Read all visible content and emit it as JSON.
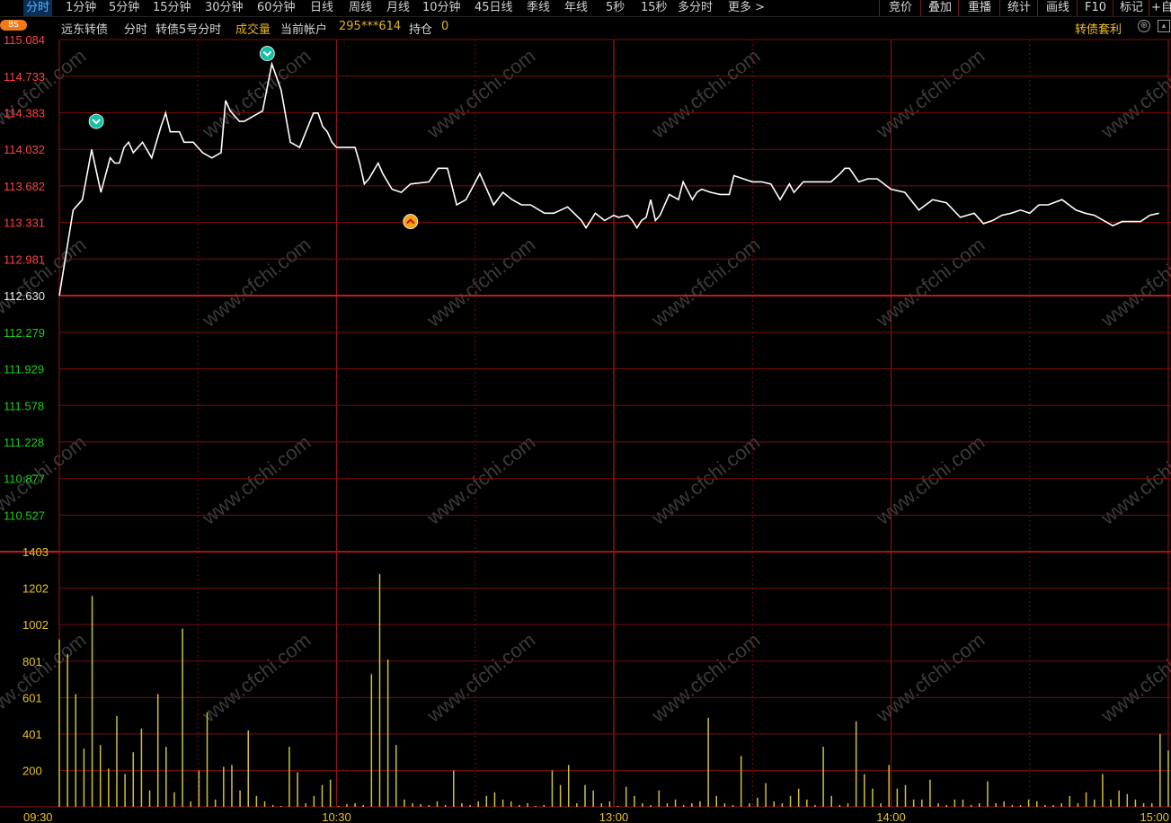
{
  "toolbar": {
    "tabs": [
      "分时",
      "1分钟",
      "5分钟",
      "15分钟",
      "30分钟",
      "60分钟",
      "日线",
      "周线",
      "月线",
      "10分钟",
      "45日线",
      "季线",
      "年线",
      "5秒",
      "15秒",
      "多分时",
      "更多 >"
    ],
    "right_buttons": [
      "竞价",
      "叠加",
      "重播",
      "统计",
      "画线",
      "F10",
      "标记",
      "+自"
    ]
  },
  "header": {
    "badge": "BS",
    "stock_name": "远东转债",
    "view": "分时",
    "chart_name": "转债5号分时",
    "volume_label": "成交量",
    "account_label": "当前帐户",
    "account_value": "295***614",
    "position_label": "持仓",
    "position_value": "0",
    "arbitrage": "转债套利"
  },
  "colors": {
    "up": "#ff4040",
    "down": "#19d019",
    "flat": "#e6e6e6",
    "volume": "#cfc13a",
    "grid": "#7a0c0c",
    "price_line": "#ffffff"
  },
  "chart_data": {
    "type": "line",
    "price": {
      "ylim": [
        110.177,
        115.084
      ],
      "prev_close": 112.63,
      "y_ticks": [
        "115.084",
        "114.733",
        "114.383",
        "114.032",
        "113.682",
        "113.331",
        "112.981",
        "112.630",
        "112.279",
        "111.929",
        "111.578",
        "111.228",
        "110.877",
        "110.527"
      ],
      "series": {
        "name": "",
        "x": [
          0,
          3,
          5,
          7,
          9,
          11,
          12,
          13,
          14,
          15,
          16,
          18,
          20,
          22,
          23,
          24,
          26,
          27,
          29,
          30,
          31,
          33,
          35,
          36,
          37,
          39,
          40,
          42,
          44,
          46,
          48,
          50,
          52,
          55,
          56,
          57,
          58,
          59,
          60,
          62,
          64,
          65,
          66,
          67,
          69,
          70,
          72,
          74,
          76,
          80,
          82,
          84,
          86,
          88,
          91,
          94,
          96,
          98,
          100,
          102,
          105,
          107,
          110,
          113,
          114,
          115,
          116,
          118,
          120,
          121,
          123,
          124,
          125,
          126,
          127,
          128,
          129,
          130,
          132,
          134,
          135,
          137,
          138,
          139,
          141,
          143,
          145,
          146,
          148,
          150,
          152,
          154,
          156,
          158,
          159,
          161,
          163,
          165,
          167,
          169,
          170,
          171,
          173,
          175,
          177,
          180,
          183,
          186,
          189,
          192,
          195,
          198,
          200,
          202,
          204,
          206,
          208,
          210,
          212,
          214,
          217,
          220,
          222,
          224,
          226,
          228,
          230,
          232,
          234,
          236,
          238,
          240
        ],
        "y": [
          112.63,
          113.45,
          113.55,
          114.03,
          113.62,
          113.95,
          113.9,
          113.9,
          114.05,
          114.1,
          114.0,
          114.1,
          113.95,
          114.25,
          114.38,
          114.2,
          114.2,
          114.1,
          114.1,
          114.05,
          114.0,
          113.95,
          114.0,
          114.5,
          114.4,
          114.3,
          114.3,
          114.35,
          114.4,
          114.85,
          114.6,
          114.1,
          114.05,
          114.38,
          114.38,
          114.25,
          114.2,
          114.1,
          114.05,
          114.05,
          114.05,
          113.9,
          113.7,
          113.75,
          113.9,
          113.8,
          113.65,
          113.62,
          113.7,
          113.72,
          113.85,
          113.85,
          113.5,
          113.55,
          113.8,
          113.5,
          113.62,
          113.55,
          113.5,
          113.5,
          113.42,
          113.42,
          113.48,
          113.35,
          113.28,
          113.35,
          113.42,
          113.35,
          113.4,
          113.38,
          113.4,
          113.35,
          113.28,
          113.35,
          113.38,
          113.55,
          113.35,
          113.4,
          113.6,
          113.55,
          113.72,
          113.55,
          113.62,
          113.65,
          113.62,
          113.6,
          113.6,
          113.78,
          113.75,
          113.72,
          113.72,
          113.7,
          113.55,
          113.7,
          113.62,
          113.72,
          113.72,
          113.72,
          113.72,
          113.8,
          113.85,
          113.85,
          113.72,
          113.75,
          113.75,
          113.65,
          113.62,
          113.45,
          113.55,
          113.52,
          113.38,
          113.42,
          113.32,
          113.35,
          113.4,
          113.42,
          113.45,
          113.42,
          113.5,
          113.5,
          113.55,
          113.45,
          113.42,
          113.4,
          113.35,
          113.3,
          113.34,
          113.34,
          113.34,
          113.4,
          113.42
        ]
      },
      "signals": [
        {
          "x": 8,
          "y": 114.3,
          "kind": "down"
        },
        {
          "x": 45,
          "y": 114.95,
          "kind": "down"
        },
        {
          "x": 76,
          "y": 113.34,
          "kind": "up"
        }
      ]
    },
    "volume": {
      "ylim": [
        0,
        1403
      ],
      "y_ticks": [
        "1403",
        "1202",
        "1002",
        "801",
        "601",
        "401",
        "200"
      ],
      "values": [
        920,
        840,
        620,
        320,
        1160,
        340,
        210,
        500,
        180,
        300,
        430,
        90,
        620,
        330,
        80,
        980,
        30,
        200,
        520,
        40,
        220,
        230,
        90,
        420,
        60,
        30,
        10,
        5,
        330,
        190,
        20,
        60,
        120,
        150,
        5,
        15,
        20,
        10,
        730,
        1280,
        810,
        340,
        40,
        20,
        15,
        10,
        30,
        10,
        200,
        20,
        10,
        30,
        60,
        80,
        40,
        30,
        10,
        20,
        5,
        10,
        200,
        120,
        230,
        20,
        120,
        90,
        20,
        30,
        5,
        110,
        60,
        20,
        10,
        90,
        20,
        40,
        10,
        20,
        30,
        490,
        60,
        20,
        10,
        280,
        20,
        50,
        130,
        30,
        20,
        60,
        100,
        40,
        10,
        330,
        60,
        10,
        20,
        470,
        180,
        100,
        20,
        230,
        100,
        120,
        40,
        40,
        150,
        20,
        10,
        40,
        40,
        10,
        20,
        140,
        20,
        30,
        10,
        10,
        40,
        30,
        10,
        10,
        20,
        60,
        20,
        80,
        40,
        180,
        40,
        90,
        70,
        40,
        20,
        20,
        400,
        310
      ]
    },
    "x_ticks": [
      {
        "x": 0,
        "label": "09:30"
      },
      {
        "x": 60,
        "label": "10:30"
      },
      {
        "x": 120,
        "label": "13:00"
      },
      {
        "x": 180,
        "label": "14:00"
      },
      {
        "x": 240,
        "label": "15:00"
      }
    ],
    "watermark": "www.cfchi.com"
  }
}
